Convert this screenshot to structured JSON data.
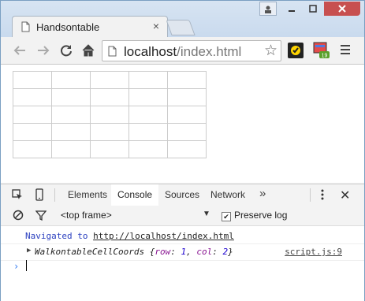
{
  "browser": {
    "tab": {
      "title": "Handsontable",
      "close": "×"
    },
    "omnibox": {
      "host": "localhost",
      "path": "/index.html"
    },
    "ext_badge": "19"
  },
  "page": {
    "grid": {
      "rows": 5,
      "cols": 5
    }
  },
  "devtools": {
    "tabs": [
      "Elements",
      "Console",
      "Sources",
      "Network"
    ],
    "active_tab": "Console",
    "more": "»",
    "close": "✕",
    "console_toolbar": {
      "frame": "<top frame>",
      "preserve_log_label": "Preserve log",
      "preserve_log_checked": true
    },
    "messages": [
      {
        "prefix": "Navigated to ",
        "link": "http://localhost/index.html"
      },
      {
        "class_name": "WalkontableCellCoords",
        "open": " {",
        "k1": "row",
        "v1": "1",
        "k2": "col",
        "v2": "2",
        "close": "}",
        "source": "script.js:9"
      }
    ],
    "prompt": "›"
  },
  "colors": {
    "console_link_blue": "#2a3fbf",
    "prompt_blue": "#367cf1",
    "window_close_red": "#c75050"
  }
}
